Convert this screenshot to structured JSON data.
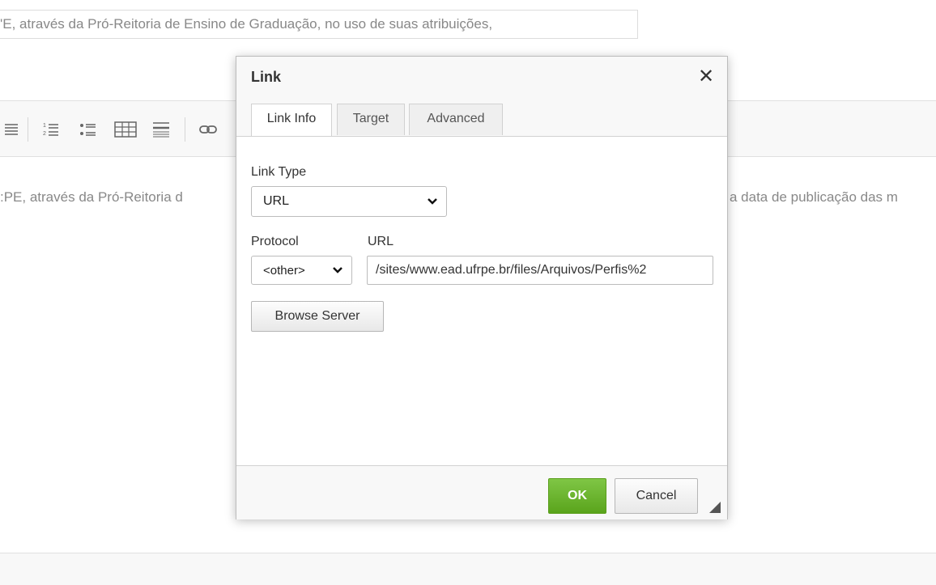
{
  "background": {
    "field_text": "'E, através da Pró-Reitoria de Ensino de Graduação, no uso de suas atribuições,",
    "body_text_left": ":PE, através da Pró-Reitoria d",
    "body_text_right": "a data de publicação das m"
  },
  "toolbar_icons": [
    "align-justify-icon",
    "numbered-list-icon",
    "bulleted-list-icon",
    "table-icon",
    "horizontal-line-icon",
    "link-icon"
  ],
  "dialog": {
    "title": "Link",
    "close_symbol": "✕",
    "tabs": [
      {
        "label": "Link Info",
        "active": true
      },
      {
        "label": "Target",
        "active": false
      },
      {
        "label": "Advanced",
        "active": false
      }
    ],
    "link_type_label": "Link Type",
    "link_type_value": "URL",
    "protocol_label": "Protocol",
    "protocol_value": "<other>",
    "url_label": "URL",
    "url_value": "/sites/www.ead.ufrpe.br/files/Arquivos/Perfis%2",
    "browse_label": "Browse Server",
    "ok_label": "OK",
    "cancel_label": "Cancel"
  },
  "colors": {
    "ok_green": "#6fb52c",
    "panel_bg": "#f8f8f8",
    "border": "#d1d1d1"
  }
}
